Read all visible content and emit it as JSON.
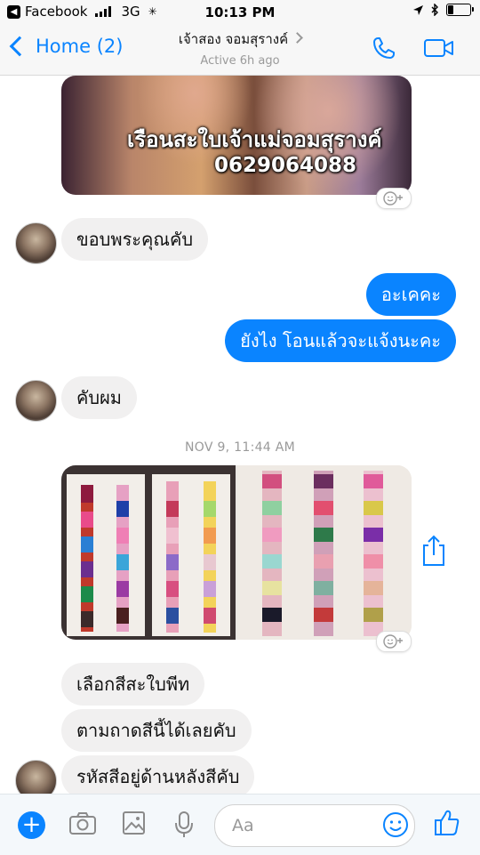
{
  "status_bar": {
    "carrier": "Facebook",
    "network": "3G",
    "time": "10:13 PM"
  },
  "header": {
    "back_label": "Home (2)",
    "contact_name": "เจ้าสอง จอมสุรางค์",
    "active_status": "Active 6h ago"
  },
  "messages": {
    "photo1_caption_line1": "เรือนสะใบเจ้าแม่จอมสุรางค์",
    "photo1_caption_line2": "0629064088",
    "m1": "ขอบพระคุณคับ",
    "m2": "อะเคคะ",
    "m3": "ยังไง โอนแล้วจะแจ้งนะคะ",
    "m4": "คับผม",
    "timestamp": "NOV 9, 11:44 AM",
    "m5": "เลือกสีสะใบพีท",
    "m6": "ตามถาดสีนี้ได้เลยคับ",
    "m7": "รหัสสีอยู่ด้านหลังสีคับ"
  },
  "composer": {
    "placeholder": "Aa"
  },
  "colors": {
    "accent": "#0a84ff",
    "incoming_bubble": "#f1f0f0"
  },
  "icons": [
    "phone-icon",
    "video-icon",
    "reaction-icon",
    "share-icon",
    "camera-icon",
    "gallery-icon",
    "microphone-icon",
    "emoji-icon",
    "thumbs-up-icon"
  ]
}
